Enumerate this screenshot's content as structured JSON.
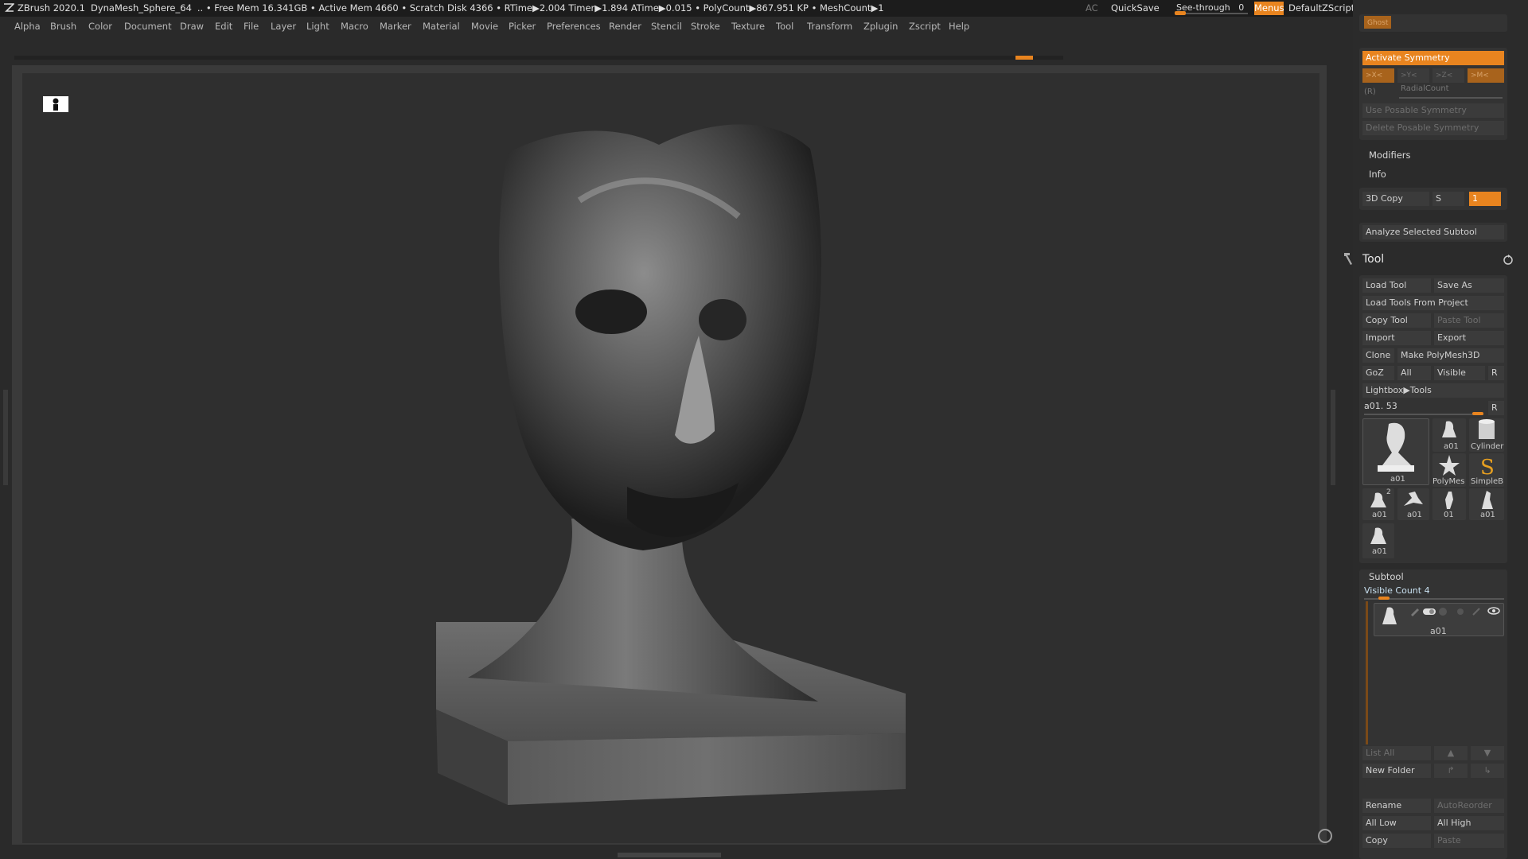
{
  "titlebar": {
    "app": "ZBrush 2020.1",
    "doc": "DynaMesh_Sphere_64",
    "stats": ".. • Free Mem 16.341GB • Active Mem 4660 • Scratch Disk 4366 •  RTime▶2.004 Timer▶1.894 ATime▶0.015 • PolyCount▶867.951 KP  • MeshCount▶1",
    "ac": "AC",
    "quicksave": "QuickSave",
    "seethrough": "See-through",
    "seethrough_value": "0",
    "menus": "Menus",
    "script": "DefaultZScript",
    "seethrough_level": 0
  },
  "menubar": [
    "Alpha",
    "Brush",
    "Color",
    "Document",
    "Draw",
    "Edit",
    "File",
    "Layer",
    "Light",
    "Macro",
    "Marker",
    "Material",
    "Movie",
    "Picker",
    "Preferences",
    "Render",
    "Stencil",
    "Stroke",
    "Texture",
    "Tool",
    "Transform",
    "Zplugin",
    "Zscript",
    "Help"
  ],
  "colors": {
    "accent": "#e8841f",
    "bg": "#2a2a2a",
    "canvas": "#2f2f2f",
    "panel": "#2b2b2b"
  },
  "symmetry": {
    "ghost": "Ghost",
    "activate": "Activate Symmetry",
    "axes": [
      ">X<",
      ">Y<",
      ">Z<",
      ">M<"
    ],
    "r": "(R)",
    "radial": "RadialCount",
    "posable": "Use Posable Symmetry",
    "delete_posable": "Delete Posable Symmetry"
  },
  "modifiers": "Modifiers",
  "info": "Info",
  "copy3d": {
    "label": "3D Copy",
    "s": "S",
    "value": "1"
  },
  "analyze": "Analyze Selected Subtool",
  "tool": {
    "title": "Tool",
    "load_tool": "Load Tool",
    "save_as": "Save As",
    "load_from_project": "Load Tools From Project",
    "copy_tool": "Copy Tool",
    "paste_tool": "Paste Tool",
    "import": "Import",
    "export": "Export",
    "clone": "Clone",
    "make_polymesh": "Make PolyMesh3D",
    "goz": "GoZ",
    "all": "All",
    "visible": "Visible",
    "r": "R",
    "lightbox": "Lightbox▶Tools",
    "current": "a01. 53",
    "thumbs": {
      "main": "a01",
      "t1": "a01",
      "t2": "Cylinder",
      "t3": "PolyMes",
      "t4": "SimpleB",
      "t5": "a01",
      "t5_badge": "2",
      "t6": "a01",
      "t7": "01",
      "t8": "a01",
      "t9": "a01"
    }
  },
  "subtool": {
    "title": "Subtool",
    "visible_count": "Visible Count 4",
    "item": "a01",
    "list_all": "List All",
    "new_folder": "New Folder",
    "rename": "Rename",
    "autoreorder": "AutoReorder",
    "all_low": "All Low",
    "all_high": "All High",
    "copy": "Copy",
    "paste": "Paste"
  }
}
